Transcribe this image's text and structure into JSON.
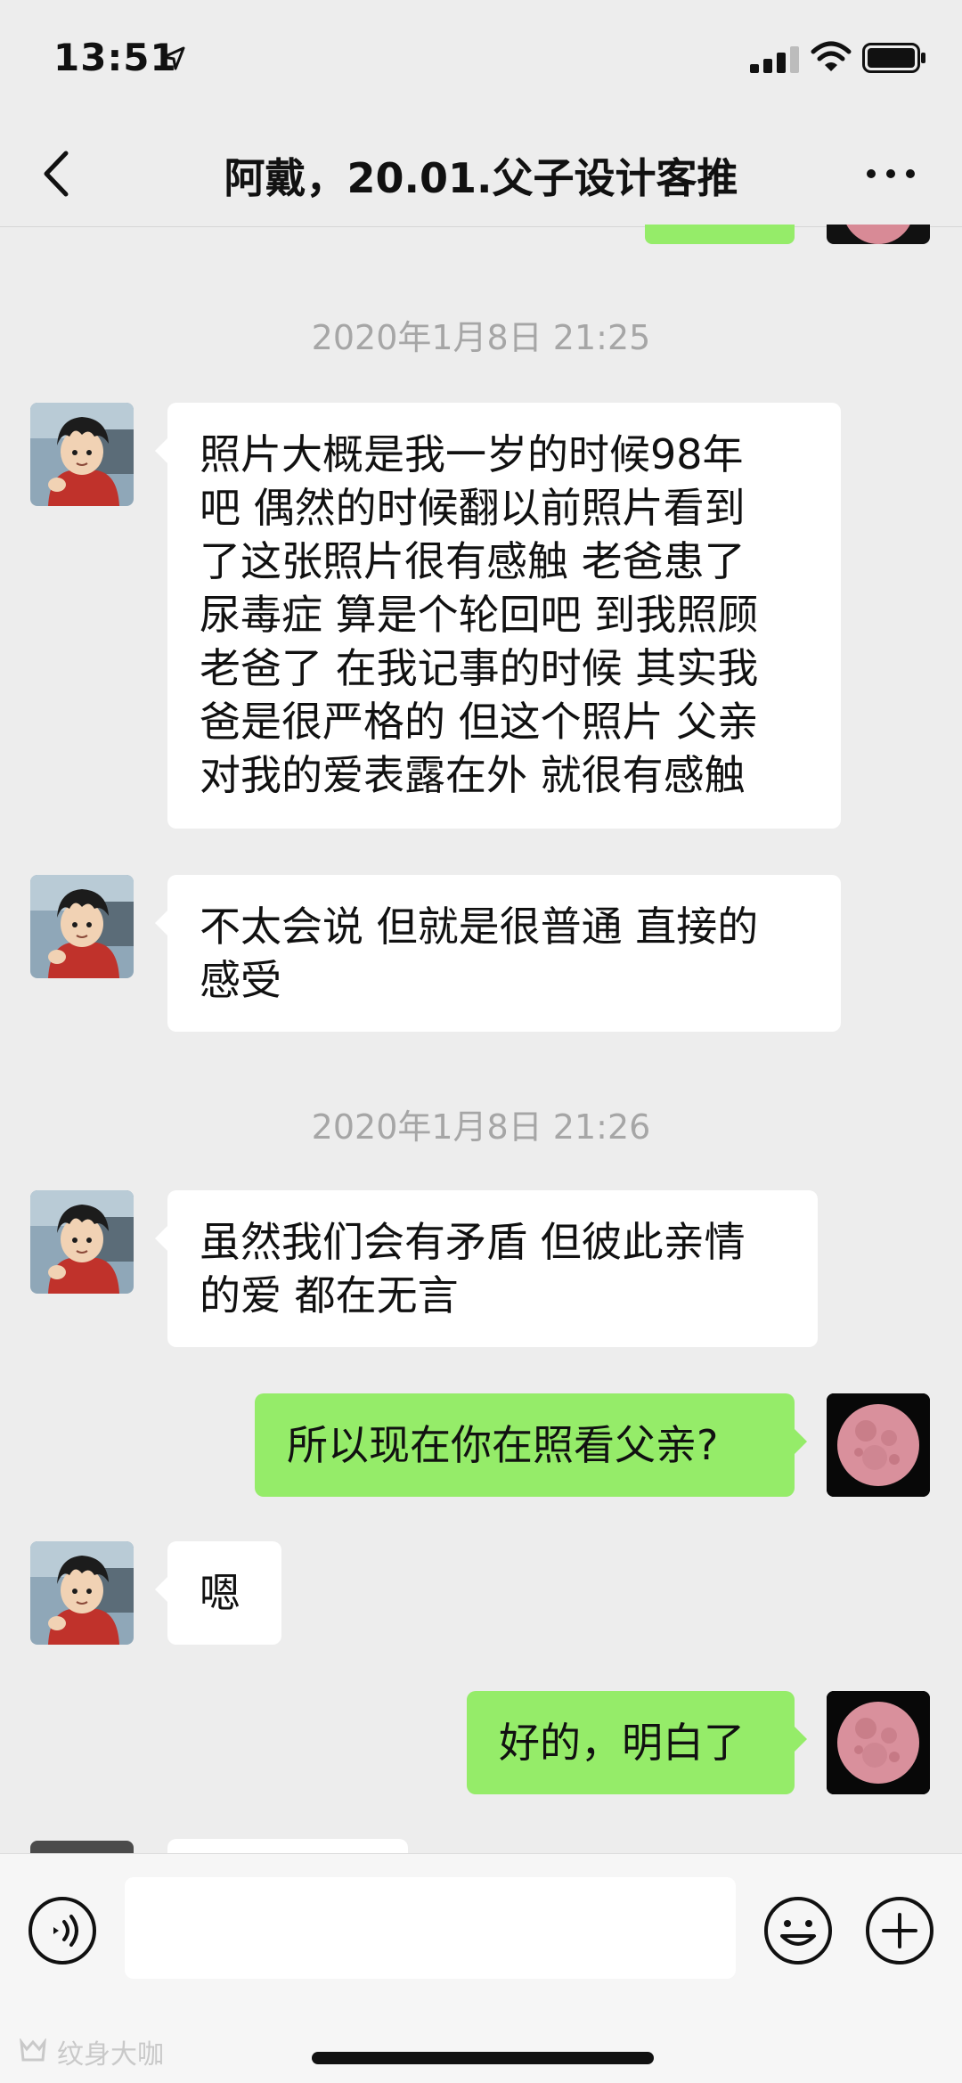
{
  "status_bar": {
    "time": "13:51"
  },
  "nav": {
    "title": "阿戴，20.01.父子设计客推"
  },
  "timestamps": [
    "2020年1月8日 21:25",
    "2020年1月8日 21:26"
  ],
  "messages": [
    {
      "side": "left",
      "lines": [
        "照片大概是我一岁的时候98年",
        "吧 偶然的时候翻以前照片看到",
        "了这张照片很有感触  老爸患了",
        "尿毒症 算是个轮回吧 到我照顾",
        "老爸了 在我记事的时候 其实我",
        "爸是很严格的 但这个照片 父亲",
        "对我的爱表露在外  就很有感触"
      ]
    },
    {
      "side": "left",
      "lines": [
        "不太会说  但就是很普通 直接的",
        "感受"
      ]
    },
    {
      "side": "left",
      "lines": [
        "虽然我们会有矛盾 但彼此亲情",
        "的爱 都在无言"
      ]
    },
    {
      "side": "right",
      "lines": [
        "所以现在你在照看父亲?"
      ]
    },
    {
      "side": "left",
      "lines": [
        "嗯"
      ]
    },
    {
      "side": "right",
      "lines": [
        "好的，明白了"
      ]
    }
  ],
  "input": {
    "placeholder": ""
  },
  "watermark": "纹身大咖",
  "colors": {
    "background": "#ededed",
    "sent_bubble": "#95ec69",
    "received_bubble": "#ffffff",
    "timestamp": "#a6a6a6"
  }
}
